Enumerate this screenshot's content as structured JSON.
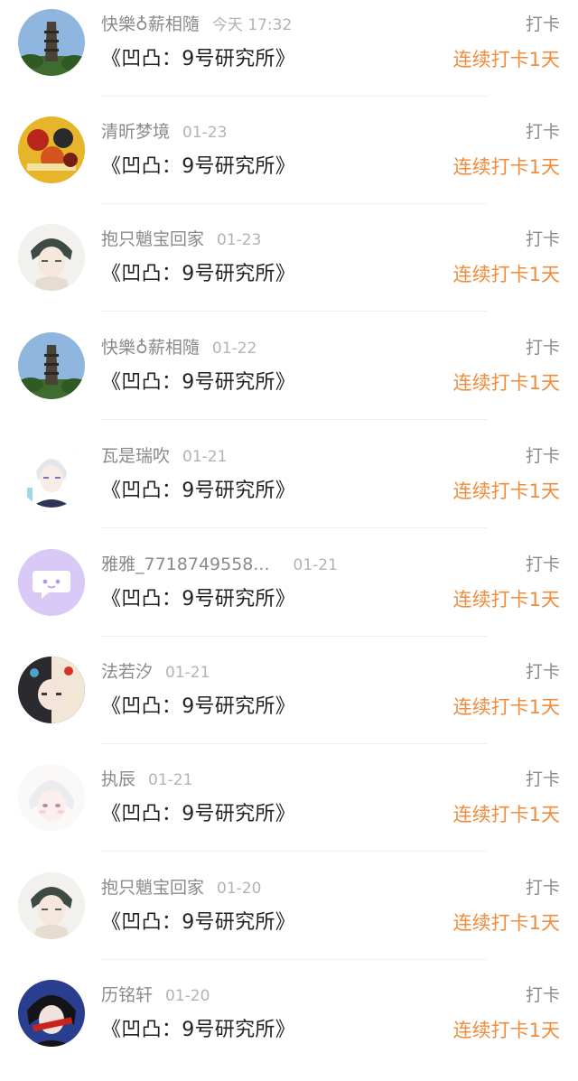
{
  "entries": [
    {
      "name": "快樂♁薪相隨",
      "date": "今天 17:32",
      "title": "《凹凸：9号研究所》",
      "tag": "打卡",
      "streak": "连续打卡1天",
      "avatar": "tower-photo"
    },
    {
      "name": "清昕梦境",
      "date": "01-23",
      "title": "《凹凸：9号研究所》",
      "tag": "打卡",
      "streak": "连续打卡1天",
      "avatar": "anime-poster"
    },
    {
      "name": "抱只魈宝回家",
      "date": "01-23",
      "title": "《凹凸：9号研究所》",
      "tag": "打卡",
      "streak": "连续打卡1天",
      "avatar": "anime-boy-sketch"
    },
    {
      "name": "快樂♁薪相隨",
      "date": "01-22",
      "title": "《凹凸：9号研究所》",
      "tag": "打卡",
      "streak": "连续打卡1天",
      "avatar": "tower-photo"
    },
    {
      "name": "瓦是瑞吹",
      "date": "01-21",
      "title": "《凹凸：9号研究所》",
      "tag": "打卡",
      "streak": "连续打卡1天",
      "avatar": "anime-white-hair"
    },
    {
      "name": "雅雅_7718749558...",
      "date": "01-21",
      "title": "《凹凸：9号研究所》",
      "tag": "打卡",
      "streak": "连续打卡1天",
      "avatar": "default-chat-bubble"
    },
    {
      "name": "法若汐",
      "date": "01-21",
      "title": "《凹凸：9号研究所》",
      "tag": "打卡",
      "streak": "连续打卡1天",
      "avatar": "anime-two-tone"
    },
    {
      "name": "执辰",
      "date": "01-21",
      "title": "《凹凸：9号研究所》",
      "tag": "打卡",
      "streak": "连续打卡1天",
      "avatar": "anime-pale-face"
    },
    {
      "name": "抱只魈宝回家",
      "date": "01-20",
      "title": "《凹凸：9号研究所》",
      "tag": "打卡",
      "streak": "连续打卡1天",
      "avatar": "anime-boy-sketch"
    },
    {
      "name": "历铭轩",
      "date": "01-20",
      "title": "《凹凸：9号研究所》",
      "tag": "打卡",
      "streak": "连续打卡1天",
      "avatar": "anime-dark-red"
    }
  ],
  "colors": {
    "streak": "#f08c3b",
    "name": "#8a8a8a",
    "date": "#b3b3b3",
    "title": "#222222",
    "default_avatar_bg": "#d8c9f7"
  }
}
